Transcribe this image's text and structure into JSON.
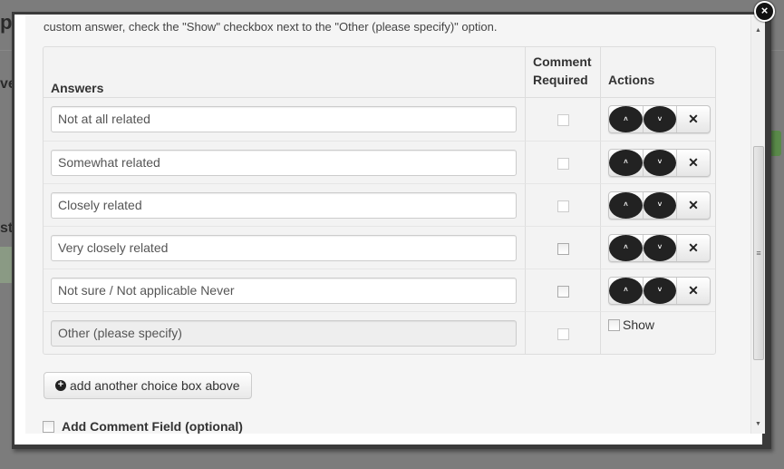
{
  "intro_text": "custom answer, check the \"Show\" checkbox next to the \"Other (please specify)\" option.",
  "table": {
    "headers": {
      "answers": "Answers",
      "comment": "Comment Required",
      "actions": "Actions"
    },
    "rows": [
      {
        "answer": "Not at all related"
      },
      {
        "answer": "Somewhat related"
      },
      {
        "answer": "Closely related"
      },
      {
        "answer": "Very closely related"
      },
      {
        "answer": "Not sure / Not applicable Never"
      }
    ],
    "other": {
      "answer": "Other (please specify)",
      "show_label": "Show"
    }
  },
  "add_choice_label": "add another choice box above",
  "comment_field_label": "Add Comment Field (optional)",
  "icons": {
    "up": "chevron-circle-up-icon",
    "down": "chevron-circle-down-icon",
    "remove": "x-icon",
    "add": "plus-circle-icon",
    "close": "close-icon"
  }
}
